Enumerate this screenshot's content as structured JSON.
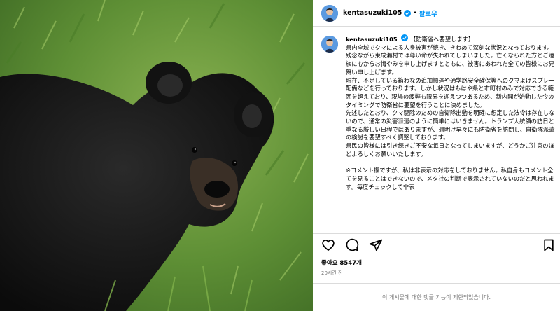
{
  "post": {
    "username": "kentasuzuki105",
    "follow_label": "팔로우",
    "dot": "•",
    "caption": {
      "username": "kentasuzuki105",
      "first_line": "【防衛省へ要望します】",
      "paragraphs": [
        "県内全域でクマによる人身被害が続き、きわめて深刻な状況となっております。",
        "残念ながら東成瀬村では尊い命が失われてしまいました。亡くなられた方とご遺族に心からお悔やみを申し上げますとともに、被害にあわれた全ての皆様にお見舞い申し上げます。",
        "現在、不足している箱わなの追加調達や通学路安全確保等へのクマよけスプレー配備などを行っております。しかし状況はもはや県と市町村のみで対応できる範囲を超えており、現場の疲弊も限界を迎えつつあるため、新内閣が始動した今のタイミングで防衛省に要望を行うことに決めました。",
        "先述したとおり、クマ駆除のための自衛隊出動を明確に想定した法令は存在しないので、通常の災害派遣のように簡単にはいきません。トランプ大統領の訪日と重なる厳しい日程ではありますが、週明け早々にも防衛省を訪問し、自衛隊派遣の検討を要望すべく調整しております。",
        "県民の皆様には引き続きご不安な毎日となってしまいますが、どうかご注意のほどよろしくお願いいたします。"
      ],
      "note": "※コメント欄ですが、私は非表示の対応をしておりません。私自身もコメント全てを見ることはできないので、メタ社の判断で表示されていないのだと思われます。毎度チェックして非表"
    },
    "likes": "좋아요 8547개",
    "time": "20시간 전",
    "comments_disabled": "이 게시물에 대한 댓글 기능이 제한되었습니다.",
    "icons": {
      "like": "heart-icon",
      "comment": "comment-icon",
      "share": "share-icon",
      "save": "bookmark-icon",
      "verified": "verified-badge-icon"
    },
    "colors": {
      "accent": "#0095f6",
      "muted": "#737373",
      "border": "#dbdbdb"
    }
  }
}
